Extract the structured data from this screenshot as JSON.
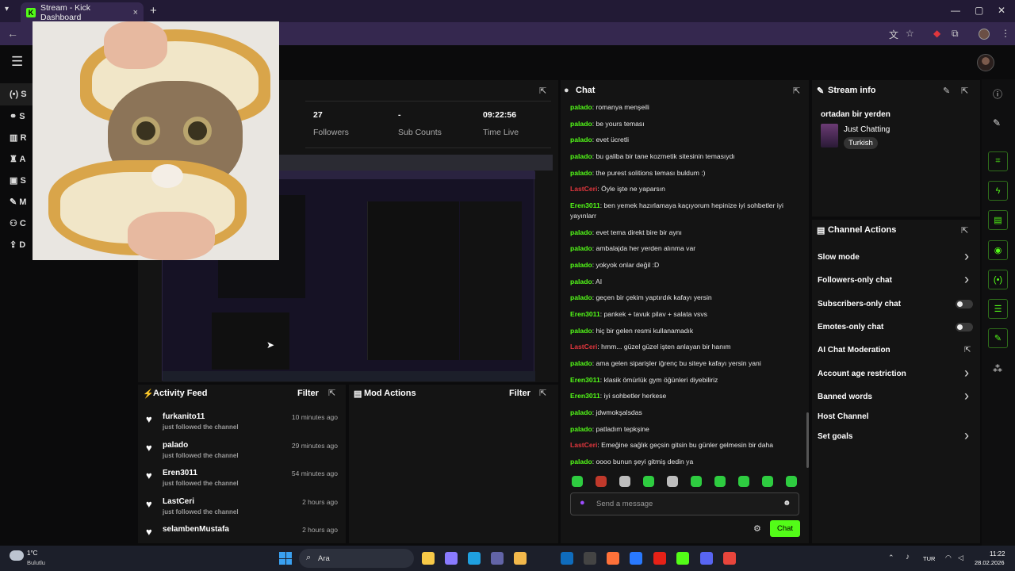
{
  "browser": {
    "tab_title": "Stream - Kick Dashboard",
    "new_tab": "+",
    "close_tab": "×",
    "window": {
      "min": "—",
      "max": "▢",
      "close": "✕"
    }
  },
  "sidebar": {
    "items": [
      {
        "label": "S"
      },
      {
        "label": "S"
      },
      {
        "label": "R"
      },
      {
        "label": "A"
      },
      {
        "label": "S"
      },
      {
        "label": "M"
      },
      {
        "label": "C"
      },
      {
        "label": "D"
      }
    ]
  },
  "stats": {
    "followers_value": "27",
    "followers_label": "Followers",
    "subs_value": "-",
    "subs_label": "Sub Counts",
    "time_value": "09:22:56",
    "time_label": "Time Live"
  },
  "activity": {
    "title": "Activity Feed",
    "filter": "Filter",
    "items": [
      {
        "name": "furkanito11",
        "sub": "just followed the channel",
        "time": "10 minutes ago"
      },
      {
        "name": "palado",
        "sub": "just followed the channel",
        "time": "29 minutes ago"
      },
      {
        "name": "Eren3011",
        "sub": "just followed the channel",
        "time": "54 minutes ago"
      },
      {
        "name": "LastCeri",
        "sub": "just followed the channel",
        "time": "2 hours ago"
      },
      {
        "name": "selambenMustafa",
        "sub": "just followed the channel",
        "time": "2 hours ago"
      }
    ]
  },
  "mod_actions": {
    "title": "Mod Actions",
    "filter": "Filter"
  },
  "chat": {
    "title": "Chat",
    "placeholder": "Send a message",
    "send": "Chat",
    "messages": [
      {
        "user": "palado",
        "text": ": romanya menşeili",
        "color": "green"
      },
      {
        "user": "palado",
        "text": ": be yours teması",
        "color": "green"
      },
      {
        "user": "palado",
        "text": ": evet ücretli",
        "color": "green"
      },
      {
        "user": "palado",
        "text": ": bu galiba bir tane kozmetik sitesinin temasıydı",
        "color": "green"
      },
      {
        "user": "palado",
        "text": ": the purest solitions teması buldum :)",
        "color": "green"
      },
      {
        "user": "LastCeri",
        "text": ": Öyle işte ne yaparsın",
        "color": "red"
      },
      {
        "user": "Eren3011",
        "text": ": ben yemek hazırlamaya kaçıyorum hepinize iyi sohbetler iyi yayınlarr",
        "color": "green"
      },
      {
        "user": "palado",
        "text": ": evet tema direkt bire bir aynı",
        "color": "green"
      },
      {
        "user": "palado",
        "text": ": ambalajda her yerden alınma var",
        "color": "green"
      },
      {
        "user": "palado",
        "text": ": yokyok onlar değil :D",
        "color": "green"
      },
      {
        "user": "palado",
        "text": ": AI",
        "color": "green"
      },
      {
        "user": "palado",
        "text": ": geçen bir çekim yaptırdık kafayı yersin",
        "color": "green"
      },
      {
        "user": "Eren3011",
        "text": ": pankek + tavuk pilav + salata vsvs",
        "color": "green"
      },
      {
        "user": "palado",
        "text": ": hiç bir gelen resmi kullanamadık",
        "color": "green"
      },
      {
        "user": "LastCeri",
        "text": ": hmm... güzel güzel işten anlayan bir hanım",
        "color": "red"
      },
      {
        "user": "palado",
        "text": ": ama gelen siparişler iğrenç bu siteye kafayı yersin yani",
        "color": "green"
      },
      {
        "user": "Eren3011",
        "text": ": klasik ömürlük gym öğünleri diyebiliriz",
        "color": "green"
      },
      {
        "user": "Eren3011",
        "text": ": iyi sohbetler herkese",
        "color": "green"
      },
      {
        "user": "palado",
        "text": ": jdwmokşalsdas",
        "color": "green"
      },
      {
        "user": "palado",
        "text": ": patladım tepkşine",
        "color": "green"
      },
      {
        "user": "LastCeri",
        "text": ": Emeğine sağlık geçsin gitsin bu günler gelmesin bir daha",
        "color": "red"
      },
      {
        "user": "palado",
        "text": ": oooo bunun şeyi gitmiş dedin ya",
        "color": "green"
      }
    ]
  },
  "stream_info": {
    "title": "Stream info",
    "stream_title": "ortadan bir yerden",
    "category": "Just Chatting",
    "tag": "Turkish"
  },
  "channel_actions": {
    "title": "Channel Actions",
    "items": [
      {
        "label": "Slow mode",
        "kind": "chevron"
      },
      {
        "label": "Followers-only chat",
        "kind": "chevron"
      },
      {
        "label": "Subscribers-only chat",
        "kind": "toggle"
      },
      {
        "label": "Emotes-only chat",
        "kind": "toggle"
      },
      {
        "label": "AI Chat Moderation",
        "kind": "external"
      },
      {
        "label": "Account age restriction",
        "kind": "chevron"
      },
      {
        "label": "Banned words",
        "kind": "chevron"
      },
      {
        "label": "Host Channel",
        "kind": "none"
      },
      {
        "label": "Set goals",
        "kind": "chevron"
      }
    ]
  },
  "taskbar": {
    "weather_temp": "1°C",
    "weather_desc": "Bulutlu",
    "search": "Ara",
    "lang": "TUR",
    "time": "11:22",
    "date": "28.02.2026"
  },
  "colors": {
    "accent": "#53fc18",
    "panel": "#141414",
    "bg": "#0b0b0c",
    "red_user": "#e0363d"
  }
}
